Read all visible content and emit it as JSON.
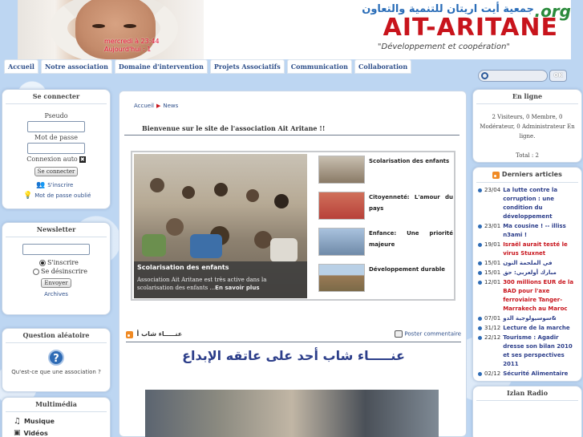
{
  "header": {
    "logo_arabic": "جمعية أيت اريتان للتنمية والتعاون",
    "logo_main": "AIT-ARITANE",
    "logo_org": ".org",
    "logo_tagline": "\"Développement et coopération\"",
    "banner_time": "mercredi à 23:44",
    "banner_date": "Aujourd'hui : 1"
  },
  "nav": {
    "tabs": [
      "Accueil",
      "Notre association",
      "Domaine d'intervention",
      "Projets Associatifs",
      "Communication",
      "Collaboration"
    ]
  },
  "search": {
    "button_label": "OK"
  },
  "login": {
    "title": "Se connecter",
    "pseudo_label": "Pseudo",
    "password_label": "Mot de passe",
    "auto_label": "Connexion auto",
    "submit_label": "Se connecter",
    "register_label": "S'inscrire",
    "forgot_label": "Mot de passe oublié"
  },
  "newsletter": {
    "title": "Newsletter",
    "subscribe_label": "S'inscrire",
    "unsubscribe_label": "Se désinscrire",
    "send_label": "Envoyer",
    "archives_label": "Archives"
  },
  "question": {
    "title": "Question aléatoire",
    "text": "Qu'est-ce que une association ?"
  },
  "multimedia": {
    "title": "Multimédia",
    "items": [
      "Musique",
      "Vidéos"
    ]
  },
  "main": {
    "breadcrumb_home": "Accueil",
    "breadcrumb_current": "News",
    "welcome": "Bienvenue sur le site de l'association Ait Aritane !!",
    "slide": {
      "title": "Scolarisation des enfants",
      "desc": "Association Ait Aritane est très active dans la scolarisation des enfants ...",
      "more": "En savoir plus"
    },
    "thumbs": [
      {
        "title": "Scolarisation des enfants",
        "color": "#8a7a66"
      },
      {
        "title": "Citoyenneté: L'amour du pays",
        "color": "#b8413a"
      },
      {
        "title": "Enfance: Une priorité majeure",
        "color": "#6f8aa8"
      },
      {
        "title": "Développement durable",
        "color": "#9a7a55"
      }
    ],
    "article_small_title": "عنـــــاء شاب أ",
    "post_comment": "Poster commentaire",
    "article_title": "عنـــــاء شاب أحد على عاتقه الإبداع"
  },
  "online": {
    "title": "En ligne",
    "stats": "2 Visiteurs, 0 Membre, 0 Modérateur, 0 Administrateur En ligne.",
    "total": "Total : 2"
  },
  "latest": {
    "title": "Derniers articles",
    "items": [
      {
        "date": "23/04",
        "text": "La lutte contre la corruption : une condition du développement",
        "red": true
      },
      {
        "date": "23/01",
        "text": "Ma cousine ! -- illiss n3ami !",
        "red": false
      },
      {
        "date": "19/01",
        "text": "Israël aurait testé le virus Stuxnet",
        "red": true
      },
      {
        "date": "15/01",
        "text": "في الملحمة النون",
        "red": false
      },
      {
        "date": "15/01",
        "text": "مبارك أولعربي: حق",
        "red": false
      },
      {
        "date": "12/01",
        "text": "300 millions EUR de la BAD pour l'axe ferroviaire Tanger-Marrakech au Maroc",
        "red": true
      },
      {
        "date": "07/01",
        "text": "سوسيولوجية الدو&",
        "red": false
      },
      {
        "date": "31/12",
        "text": "Lecture de la marche",
        "red": false
      },
      {
        "date": "22/12",
        "text": "Tourisme : Agadir dresse son bilan 2010 et ses perspectives 2011",
        "red": false
      },
      {
        "date": "02/12",
        "text": "Sécurité Alimentaire",
        "red": false
      }
    ]
  },
  "radio": {
    "title": "Izlan Radio"
  }
}
